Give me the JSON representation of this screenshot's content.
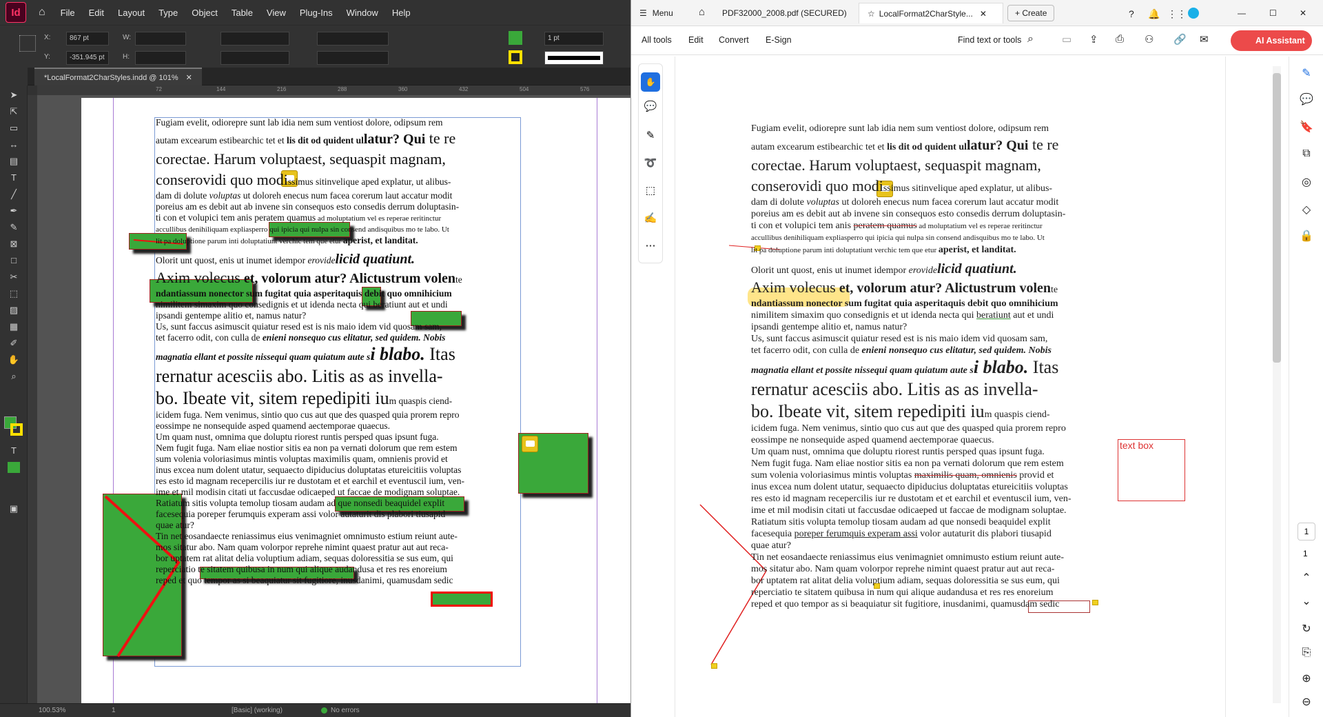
{
  "indesign": {
    "logo": "Id",
    "menu": [
      "File",
      "Edit",
      "Layout",
      "Type",
      "Object",
      "Table",
      "View",
      "Plug-Ins",
      "Window",
      "Help"
    ],
    "x_label": "X:",
    "y_label": "Y:",
    "w_label": "W:",
    "h_label": "H:",
    "x_value": "867 pt",
    "y_value": "-351.945 pt",
    "stroke_weight": "1 pt",
    "doc_tab": "*LocalFormat2CharStyles.indd @ 101%",
    "ruler_marks": [
      "72",
      "144",
      "216",
      "288",
      "360",
      "432",
      "504",
      "576"
    ],
    "zoom": "100.53%",
    "page_num": "1",
    "style_status": "[Basic] (working)",
    "preflight": "No errors",
    "colors": {
      "fill": "#3aa83a",
      "stroke": "#ffe000"
    }
  },
  "text": {
    "p1a": "Fugiam evelit, odiorepre sunt lab idia nem sum ventiost dolore, odipsum rem",
    "p1b_a": "autam excearum estibearchic tet et ",
    "p1b_b": "lis dit od quident ul",
    "p1b_c": "latur? Qui",
    "p1b_d": " te re",
    "p1c": "corectae. Harum voluptaest, sequaspit magnam,",
    "p1d_a": "conserovidi quo ",
    "p1d_b": "modi",
    "p1d_c": "ssimus sitinvelique aped explatur, ut alibus-",
    "p1e_a": "dam di dolute ",
    "p1e_b": "voluptas",
    "p1e_c": " ut doloreh enecus num facea corerum laut accatur modit",
    "p1f": "poreius am es debit aut ab invene sin consequos esto consedis derrum doluptasin-",
    "p1g_a": "ti con et volupici tem anis ",
    "p1g_b": "peratem quamus",
    "p1g_c": " ad moluptatium vel es reperae reritinctur",
    "p1h": "accullibus denihiliquam expliasperro qui ipicia qui nulpa sin consend andisquibus mo te labo. Ut",
    "p1i_a": "lit pa doluptione parum inti doluptatiunt verchic tem que etur ",
    "p1i_b": "aperist, et landitat.",
    "p2a_a": "Olorit unt quost, enis ut inumet idempor ",
    "p2a_b": "erovide",
    "p2a_c": "licid quatiunt.",
    "p2b_a": "Axim volecus",
    "p2b_b": " et, volorum atur? Alictustrum volen",
    "p2b_c": "te",
    "p2c_a": "ndantiassum nonector",
    "p2c_b": " sum fugitat quia asperitaquis debit quo omnihicium",
    "p2d_a": "nimilitem simaxim quo consedignis et ut idenda necta qui ",
    "p2d_b": "beratiunt",
    "p2d_c": " aut et undi",
    "p2e": "ipsandi gentempe alitio et, namus natur?",
    "p2f": "Us, sunt faccus asimuscit quiatur resed est is nis maio idem vid quosam sam,",
    "p2g_a": "tet facerro odit, con culla de ",
    "p2g_b": "enieni nonsequo cus elitatur, sed quidem. Nobis",
    "p2h_a": "magnatia ellant et possite nissequi quam quiatum aute s",
    "p2h_b": "i blabo.",
    "p2h_c": " Itas",
    "p2i": "rernatur acesciis abo. Litis as as invella-",
    "p2j_a": "bo. Ibeate vit, sitem repedipiti iu",
    "p2j_b": "m quaspis ciend-",
    "p3a": "icidem fuga. Nem venimus, sintio quo cus aut que des quasped quia prorem repro",
    "p3b": "eossimpe ne nonsequide asped quamend aectemporae quaecus.",
    "p3c": "Um quam nust, omnima que doluptu riorest runtis persped quas ipsunt fuga.",
    "p3d": "Nem fugit fuga. Nam eliae nostior sitis ea non pa vernati dolorum que rem estem",
    "p3e_a": "sum volenia voloriasimus mintis voluptas ",
    "p3e_b": "maximilis quam, omnienis",
    "p3e_c": " provid et",
    "p3f": "inus excea num dolent utatur, sequaecto dipiducius doluptatas etureicitiis voluptas",
    "p3g": "res esto id magnam recepercilis iur re dustotam et et earchil et eventuscil ium, ven-",
    "p3h": "ime et mil modisin citati ut faccusdae odicaeped ut faccae de modignam soluptae.",
    "p3i": "Ratiatum sitis volupta temolup tiosam audam ad que nonsedi beaquidel explit",
    "p3j_a": "facesequia ",
    "p3j_b": "poreper ferumquis experam assi",
    "p3j_c": " volor autaturit dis plabori tiusapid",
    "p3k": "quae atur?",
    "p3l_a": "Tin net eosandaecte reniassimus eius venimagniet omnimusto ",
    "p3l_b": "estium reiunt",
    "p3l_c": " aute-",
    "p3m": "mos sitatur abo. Nam quam volorpor reprehe nimint quaest pratur aut aut reca-",
    "p3n": "bor uptatem rat alitat delia voluptium adiam, sequas doloressitia se sus eum, qui",
    "p3o": "reperciatio te sitatem quibusa in num qui alique audandusa et res res enoreium",
    "p3p": "reped et quo tempor as si beaquiatur sit fugitiore, inusdanimi, quamusdam sedic"
  },
  "acrobat": {
    "menu_label": "Menu",
    "tab1": "PDF32000_2008.pdf (SECURED)",
    "tab2": "LocalFormat2CharStyle...",
    "create": "Create",
    "tools": [
      "All tools",
      "Edit",
      "Convert",
      "E-Sign"
    ],
    "find": "Find text or tools",
    "ai_assistant": "AI Assistant",
    "text_box_label": "text box",
    "page_current": "1",
    "page_total": "1"
  }
}
